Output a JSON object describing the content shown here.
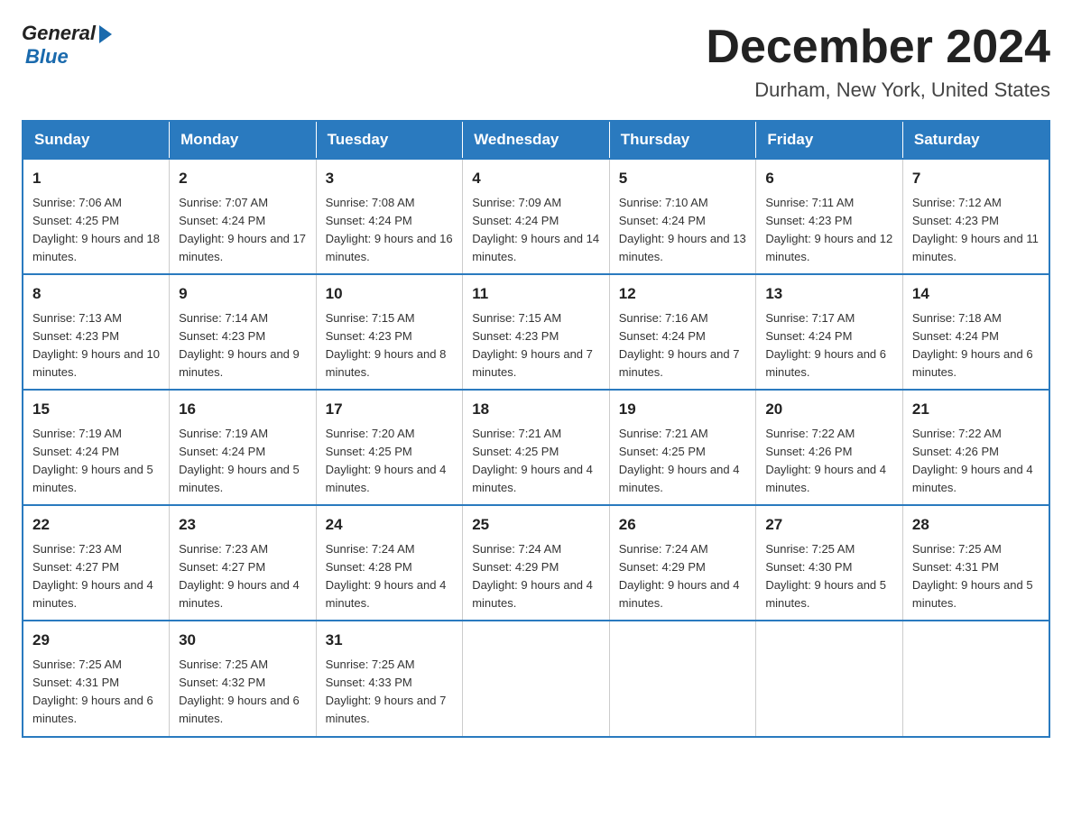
{
  "header": {
    "logo_general": "General",
    "logo_blue": "Blue",
    "month_title": "December 2024",
    "location": "Durham, New York, United States"
  },
  "days_of_week": [
    "Sunday",
    "Monday",
    "Tuesday",
    "Wednesday",
    "Thursday",
    "Friday",
    "Saturday"
  ],
  "weeks": [
    [
      {
        "day": "1",
        "sunrise": "7:06 AM",
        "sunset": "4:25 PM",
        "daylight": "9 hours and 18 minutes."
      },
      {
        "day": "2",
        "sunrise": "7:07 AM",
        "sunset": "4:24 PM",
        "daylight": "9 hours and 17 minutes."
      },
      {
        "day": "3",
        "sunrise": "7:08 AM",
        "sunset": "4:24 PM",
        "daylight": "9 hours and 16 minutes."
      },
      {
        "day": "4",
        "sunrise": "7:09 AM",
        "sunset": "4:24 PM",
        "daylight": "9 hours and 14 minutes."
      },
      {
        "day": "5",
        "sunrise": "7:10 AM",
        "sunset": "4:24 PM",
        "daylight": "9 hours and 13 minutes."
      },
      {
        "day": "6",
        "sunrise": "7:11 AM",
        "sunset": "4:23 PM",
        "daylight": "9 hours and 12 minutes."
      },
      {
        "day": "7",
        "sunrise": "7:12 AM",
        "sunset": "4:23 PM",
        "daylight": "9 hours and 11 minutes."
      }
    ],
    [
      {
        "day": "8",
        "sunrise": "7:13 AM",
        "sunset": "4:23 PM",
        "daylight": "9 hours and 10 minutes."
      },
      {
        "day": "9",
        "sunrise": "7:14 AM",
        "sunset": "4:23 PM",
        "daylight": "9 hours and 9 minutes."
      },
      {
        "day": "10",
        "sunrise": "7:15 AM",
        "sunset": "4:23 PM",
        "daylight": "9 hours and 8 minutes."
      },
      {
        "day": "11",
        "sunrise": "7:15 AM",
        "sunset": "4:23 PM",
        "daylight": "9 hours and 7 minutes."
      },
      {
        "day": "12",
        "sunrise": "7:16 AM",
        "sunset": "4:24 PM",
        "daylight": "9 hours and 7 minutes."
      },
      {
        "day": "13",
        "sunrise": "7:17 AM",
        "sunset": "4:24 PM",
        "daylight": "9 hours and 6 minutes."
      },
      {
        "day": "14",
        "sunrise": "7:18 AM",
        "sunset": "4:24 PM",
        "daylight": "9 hours and 6 minutes."
      }
    ],
    [
      {
        "day": "15",
        "sunrise": "7:19 AM",
        "sunset": "4:24 PM",
        "daylight": "9 hours and 5 minutes."
      },
      {
        "day": "16",
        "sunrise": "7:19 AM",
        "sunset": "4:24 PM",
        "daylight": "9 hours and 5 minutes."
      },
      {
        "day": "17",
        "sunrise": "7:20 AM",
        "sunset": "4:25 PM",
        "daylight": "9 hours and 4 minutes."
      },
      {
        "day": "18",
        "sunrise": "7:21 AM",
        "sunset": "4:25 PM",
        "daylight": "9 hours and 4 minutes."
      },
      {
        "day": "19",
        "sunrise": "7:21 AM",
        "sunset": "4:25 PM",
        "daylight": "9 hours and 4 minutes."
      },
      {
        "day": "20",
        "sunrise": "7:22 AM",
        "sunset": "4:26 PM",
        "daylight": "9 hours and 4 minutes."
      },
      {
        "day": "21",
        "sunrise": "7:22 AM",
        "sunset": "4:26 PM",
        "daylight": "9 hours and 4 minutes."
      }
    ],
    [
      {
        "day": "22",
        "sunrise": "7:23 AM",
        "sunset": "4:27 PM",
        "daylight": "9 hours and 4 minutes."
      },
      {
        "day": "23",
        "sunrise": "7:23 AM",
        "sunset": "4:27 PM",
        "daylight": "9 hours and 4 minutes."
      },
      {
        "day": "24",
        "sunrise": "7:24 AM",
        "sunset": "4:28 PM",
        "daylight": "9 hours and 4 minutes."
      },
      {
        "day": "25",
        "sunrise": "7:24 AM",
        "sunset": "4:29 PM",
        "daylight": "9 hours and 4 minutes."
      },
      {
        "day": "26",
        "sunrise": "7:24 AM",
        "sunset": "4:29 PM",
        "daylight": "9 hours and 4 minutes."
      },
      {
        "day": "27",
        "sunrise": "7:25 AM",
        "sunset": "4:30 PM",
        "daylight": "9 hours and 5 minutes."
      },
      {
        "day": "28",
        "sunrise": "7:25 AM",
        "sunset": "4:31 PM",
        "daylight": "9 hours and 5 minutes."
      }
    ],
    [
      {
        "day": "29",
        "sunrise": "7:25 AM",
        "sunset": "4:31 PM",
        "daylight": "9 hours and 6 minutes."
      },
      {
        "day": "30",
        "sunrise": "7:25 AM",
        "sunset": "4:32 PM",
        "daylight": "9 hours and 6 minutes."
      },
      {
        "day": "31",
        "sunrise": "7:25 AM",
        "sunset": "4:33 PM",
        "daylight": "9 hours and 7 minutes."
      },
      null,
      null,
      null,
      null
    ]
  ]
}
